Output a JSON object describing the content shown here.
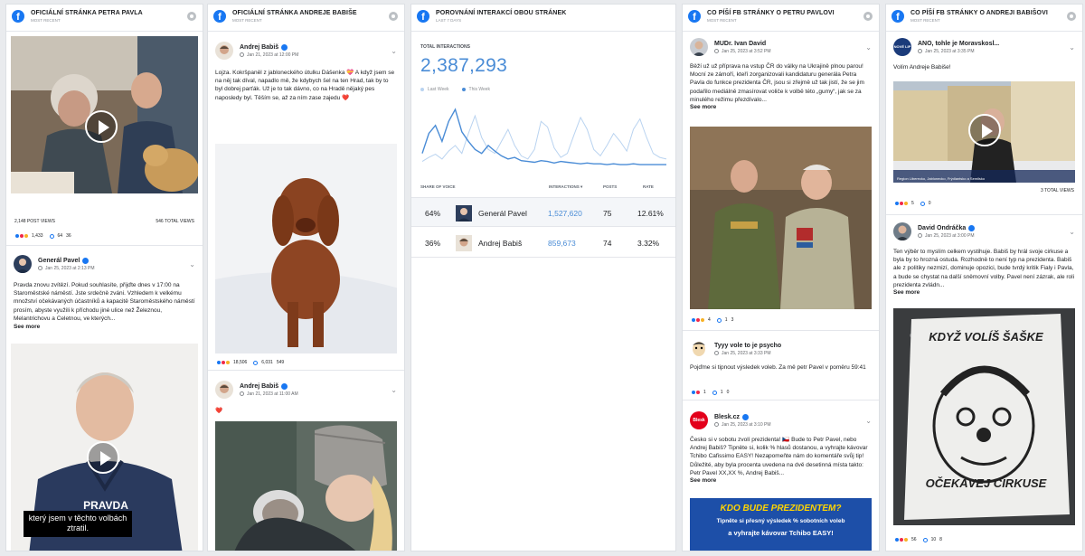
{
  "columns": [
    {
      "title": "OFICIÁLNÍ STRÁNKA PETRA PAVLA",
      "sub": "MOST RECENT"
    },
    {
      "title": "OFICIÁLNÍ STRÁNKA ANDREJE BABIŠE",
      "sub": "MOST RECENT"
    },
    {
      "title": "POROVNÁNÍ INTERAKCÍ OBOU STRÁNEK",
      "sub": "LAST 7 DAYS"
    },
    {
      "title": "CO PÍŠÍ FB STRÁNKY O PETRU PAVLOVI",
      "sub": "MOST RECENT"
    },
    {
      "title": "CO PÍŠÍ FB STRÁNKY O ANDREJI BABIŠOVI",
      "sub": "MOST RECENT"
    }
  ],
  "col1": {
    "video1": {
      "post_views": "2,148 POST VIEWS",
      "total_views": "546 TOTAL VIEWS",
      "reactions": "1,433",
      "comments": "64",
      "shares": "36"
    },
    "post2": {
      "name": "Generál Pavel",
      "date": "Jan 25, 2023 at 2:13 PM",
      "text": "Pravda znovu zvítězí. Pokud souhlasíte, přijďte dnes v 17:00 na Staroměstské náměstí. Jste srdečně zváni. Vzhledem k velkému množství očekávaných účastníků a kapacitě Staroměstského náměstí prosím, abyste využili k příchodu jiné ulice než Železnou, Melantrichovu a Celetnou, ve kterých...",
      "see_more": "See more",
      "subtitle": "který jsem v těchto volbách ztratil.",
      "shirt_text": "PRAVDA ZVÍTĚZÍ"
    }
  },
  "col2": {
    "post1": {
      "name": "Andrej Babiš",
      "date": "Jan 21, 2023 at 12:00 PM",
      "text": "Lojza. Kokršpaněl z jabloneckého útulku Dášenka 💝 A když jsem se na něj tak díval, napadlo mě, že kdybych šel na ten Hrad, tak by to byl dobrej parťák. Už je to tak dávno, co na Hradě nějaký pes naposledy byl. Těším se, až za ním zase zajedu ❤️",
      "reactions": "18,506",
      "comments": "6,031",
      "shares": "549"
    },
    "post2": {
      "name": "Andrej Babiš",
      "date": "Jan 21, 2023 at 11:00 AM",
      "text": "❤️"
    }
  },
  "col3": {
    "total_label": "TOTAL INTERACTIONS",
    "total_value": "2,387,293",
    "legend_last": "Last Week",
    "legend_this": "This Week",
    "headers": {
      "sov": "SHARE OF VOICE",
      "interactions": "INTERACTIONS ▾",
      "posts": "POSTS",
      "rate": "RATE"
    },
    "rows": [
      {
        "share": "64%",
        "name": "Generál Pavel",
        "interactions": "1,527,620",
        "posts": "75",
        "rate": "12.61%"
      },
      {
        "share": "36%",
        "name": "Andrej Babiš",
        "interactions": "859,673",
        "posts": "74",
        "rate": "3.32%"
      }
    ],
    "colors": {
      "last_week": "#b9d3f0",
      "this_week": "#4a8cd6"
    }
  },
  "chart_data": {
    "type": "line",
    "series": [
      {
        "name": "Last Week",
        "values": [
          5,
          10,
          14,
          8,
          18,
          25,
          15,
          40,
          62,
          35,
          20,
          15,
          30,
          45,
          25,
          12,
          8,
          20,
          55,
          48,
          22,
          10,
          15,
          38,
          60,
          45,
          20,
          12,
          25,
          40,
          30,
          18,
          45,
          58,
          35,
          15,
          10,
          8
        ]
      },
      {
        "name": "This Week",
        "values": [
          15,
          40,
          50,
          30,
          55,
          70,
          42,
          30,
          20,
          15,
          25,
          18,
          12,
          8,
          10,
          6,
          5,
          4,
          6,
          5,
          3,
          5,
          4,
          3,
          2,
          3,
          2,
          2,
          1,
          2,
          1,
          1,
          2,
          1,
          1,
          1,
          1,
          1
        ]
      }
    ]
  },
  "col4": {
    "post1": {
      "name": "MUDr. Ivan David",
      "date": "Jan 25, 2023 at 3:52 PM",
      "text": "Běží už už příprava na vstup ČR do války na Ukrajině plnou parou! Mocní ze zámoří, kteří zorganizovali kandidaturu generála Petra Pavla do funkce prezidenta ČR, jsou si zřejmě už tak jistí, že se jim podařilo mediálně zmasírovat voliče k volbě této „gumy“, jak se za minulého režimu přezdívalo...",
      "see_more": "See more",
      "reactions": "4",
      "comments": "1",
      "shares": "3"
    },
    "post2": {
      "name": "Tyyy vole to je psycho",
      "date": "Jan 25, 2023 at 3:33 PM",
      "text": "Pojďme si tipnout výsledek voleb. Za mě petr Pavel v poměru 59:41",
      "reactions": "1",
      "comments": "1",
      "shares": "0"
    },
    "post3": {
      "name": "Blesk.cz",
      "date": "Jan 25, 2023 at 3:10 PM",
      "text": "Česko si v sobotu zvolí prezidenta! 🇨🇿 Bude to Petr Pavel, nebo Andrej Babiš? Tipněte si, kolik % hlasů dostanou, a vyhrajte kávovar Tchibo Cafissimo EASY! Nezapomeňte nám do komentáře svůj tip! Důležité, aby byla procenta uvedena na dvě desetinná místa takto: Petr Pavel XX,XX %, Andrej Babiš...",
      "see_more": "See more",
      "logo": "Blesk",
      "banner_title": "KDO BUDE PREZIDENTEM?",
      "banner_line1": "Tipněte si přesný výsledek % sobotních voleb",
      "banner_line2": "a vyhrajte kávovar Tchibo EASY!"
    }
  },
  "col5": {
    "post1": {
      "name": "ANO, tohle je Moravskosl...",
      "date": "Jan 25, 2023 at 3:35 PM",
      "text": "Volím Andreje Babiše!",
      "caption": "Region Liberecko, Jablonecko, Frýdlantsko a Semilsko",
      "post_views": "",
      "total_views": "3 TOTAL VIEWS",
      "reactions": "5",
      "comments": "0",
      "avatar_text": "NOVÉ LIP"
    },
    "post2": {
      "name": "David Ondráčka",
      "date": "Jan 25, 2023 at 3:00 PM",
      "text": "Ten výběr to myslím celkem vystihuje. Babiš by hrál svoje cirkuse a byla by to hrozná ostuda. Rozhodně to není typ na prezidenta. Babiš ale z politiky nezmizí, dominuje opozici, bude tvrdý kritik Fialy i Pavla, a bude se chystat na další sněmovní volby. Pavel není zázrak, ale roli prezidenta zvládn...",
      "see_more": "See more",
      "reactions": "56",
      "comments": "10",
      "shares": "8",
      "sign_top": "KDYŽ VOLÍŠ ŠAŠKE",
      "sign_bottom": "OČEKÁVEJ CIRKUSE"
    }
  }
}
